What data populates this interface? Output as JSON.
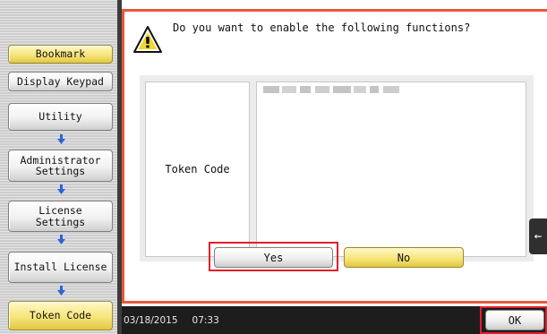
{
  "sidebar": {
    "bookmark": "Bookmark",
    "display_keypad": "Display Keypad",
    "steps": [
      {
        "label": "Utility"
      },
      {
        "label": "Administrator\nSettings"
      },
      {
        "label": "License\nSettings"
      },
      {
        "label": "Install License"
      },
      {
        "label": "Token Code"
      }
    ]
  },
  "dialog": {
    "message": "Do you want to enable the following functions?",
    "row_label": "Token Code",
    "yes_label": "Yes",
    "no_label": "No",
    "side_tab_glyph": "←"
  },
  "status": {
    "date": "03/18/2015",
    "time": "07:33",
    "ok_label": "OK"
  },
  "colors": {
    "dialog_border": "#e8583a",
    "highlight": "#e0202a",
    "yellow_button": "#f7e57b",
    "status_bar": "#1d1d1d"
  },
  "icons": {
    "warning": "warning-triangle-icon",
    "arrow": "arrow-down-icon"
  }
}
